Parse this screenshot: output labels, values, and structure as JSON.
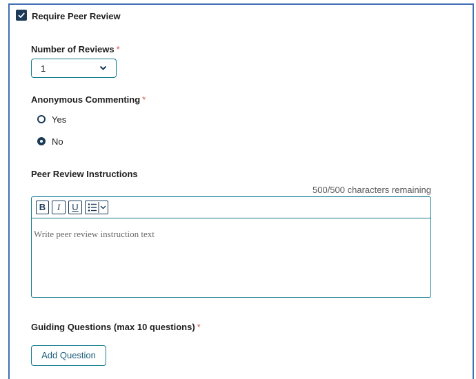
{
  "require_peer_review": {
    "label": "Require Peer Review",
    "checked": true
  },
  "number_of_reviews": {
    "label": "Number of Reviews",
    "required_mark": "*",
    "selected": "1"
  },
  "anonymous_commenting": {
    "label": "Anonymous Commenting",
    "required_mark": "*",
    "options": [
      {
        "label": "Yes",
        "selected": false
      },
      {
        "label": "No",
        "selected": true
      }
    ]
  },
  "peer_review_instructions": {
    "label": "Peer Review Instructions",
    "counter": "500/500 characters remaining",
    "placeholder": "Write peer review instruction text",
    "toolbar": {
      "bold": "B",
      "italic": "I",
      "underline": "U"
    }
  },
  "guiding_questions": {
    "label": "Guiding Questions (max 10 questions)",
    "required_mark": "*",
    "add_button": "Add Question"
  },
  "colors": {
    "frame": "#3f6fb4",
    "accent": "#117a8b",
    "dark": "#1b3a57",
    "required": "#d9534f"
  }
}
